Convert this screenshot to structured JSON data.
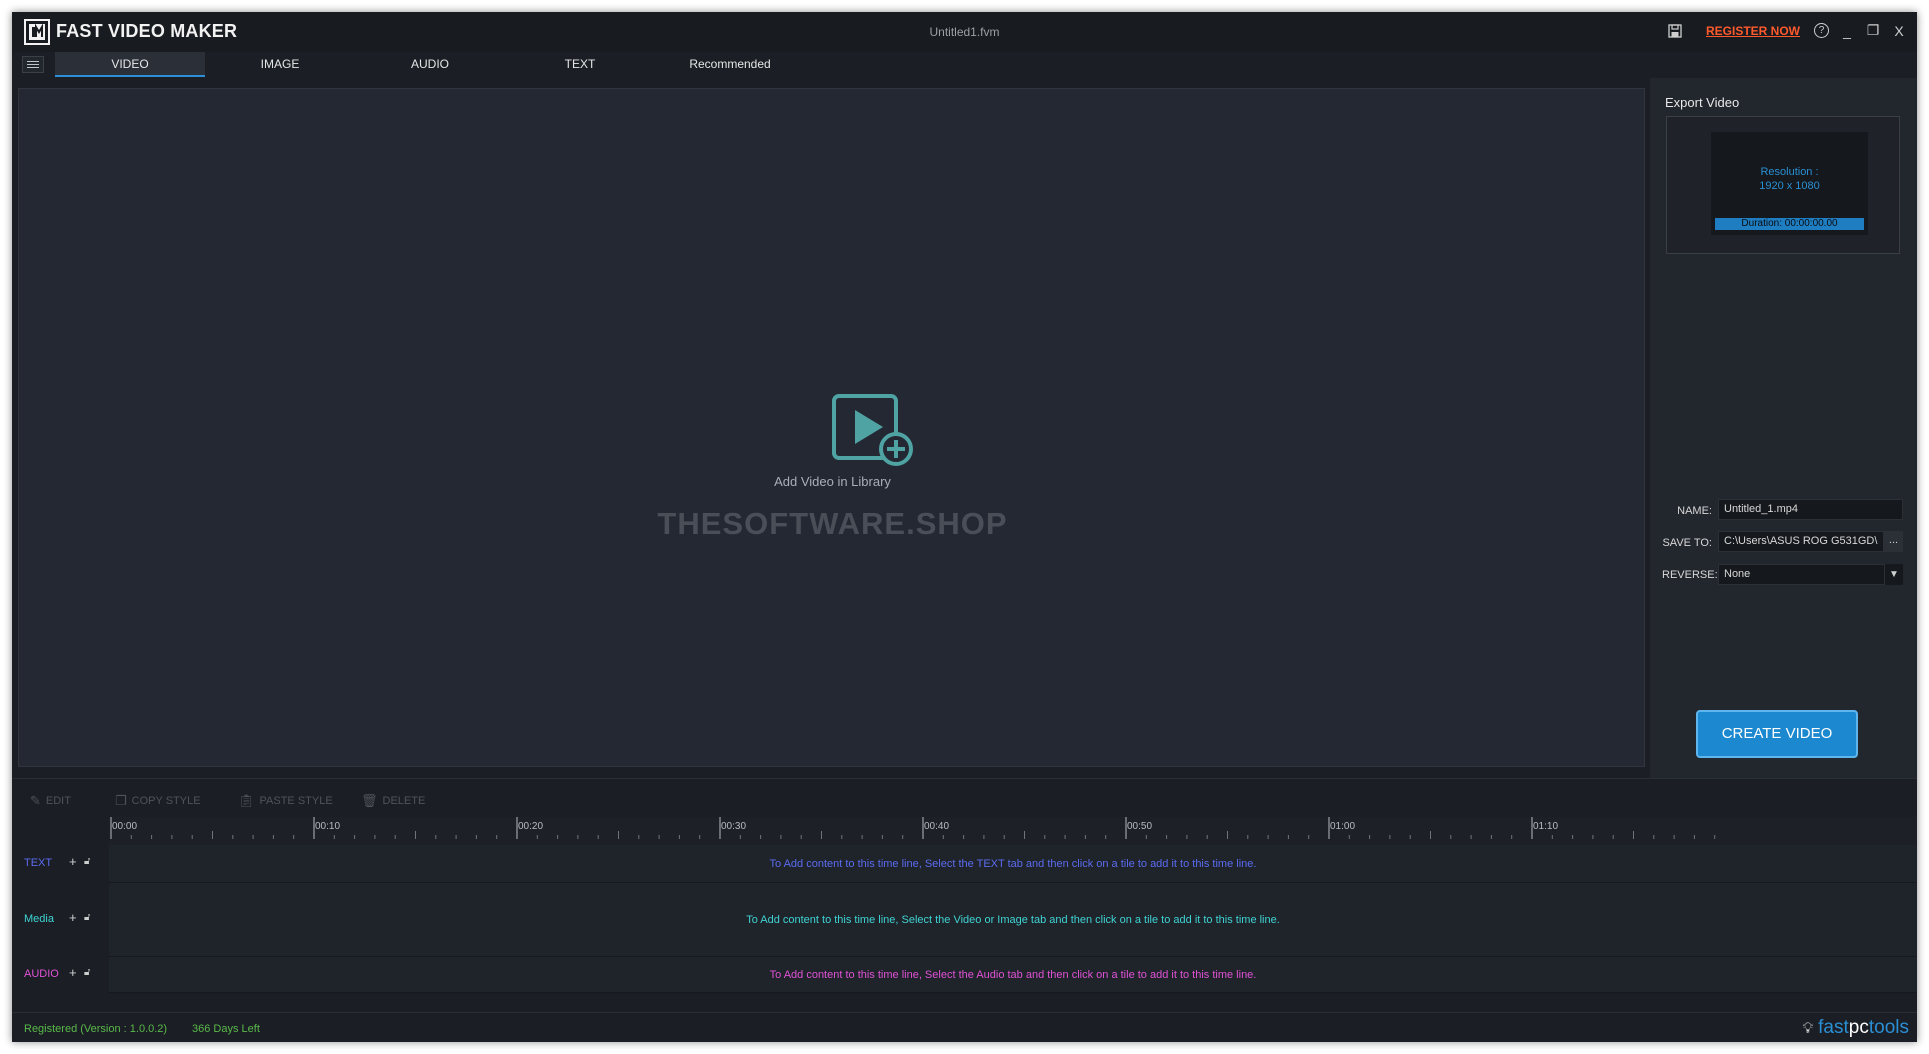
{
  "title_bar": {
    "app_name": "FAST VIDEO MAKER",
    "document_title": "Untitled1.fvm",
    "register_label": "REGISTER NOW",
    "help_symbol": "?",
    "minimize_symbol": "_",
    "restore_symbol": "❐",
    "close_symbol": "X"
  },
  "tabs": [
    "VIDEO",
    "IMAGE",
    "AUDIO",
    "TEXT",
    "Recommended"
  ],
  "active_tab": "VIDEO",
  "preview": {
    "add_label": "Add Video in Library",
    "watermark": "THESOFTWARE.SHOP"
  },
  "export": {
    "title": "Export Video",
    "resolution_label": "Resolution :",
    "resolution_value": "1920 x 1080",
    "duration": "Duration: 00:00:00.00",
    "name_label": "NAME:",
    "name_value": "Untitled_1.mp4",
    "save_to_label": "SAVE TO:",
    "save_to_value": "C:\\Users\\ASUS ROG G531GD\\",
    "browse_label": "...",
    "reverse_label": "REVERSE:",
    "reverse_value": "None",
    "create_label": "CREATE VIDEO"
  },
  "toolbar": {
    "edit": "EDIT",
    "copy_style": "COPY STYLE",
    "paste_style": "PASTE STYLE",
    "delete": "DELETE"
  },
  "timeline": {
    "ticks": [
      "00:00",
      "00:10",
      "00:20",
      "00:30",
      "00:40",
      "00:50",
      "01:00",
      "01:10"
    ],
    "tracks": [
      {
        "name": "TEXT",
        "color": "#5b6cf0",
        "hint": "To Add content to this time line, Select the TEXT tab and then click on a tile to add it to this time line."
      },
      {
        "name": "Media",
        "color": "#3fd4d4",
        "hint": "To Add content to this time line, Select the Video or Image tab and then click on a tile to add it to this time line."
      },
      {
        "name": "AUDIO",
        "color": "#e052d6",
        "hint": "To Add content to this time line, Select the Audio tab and then click on a tile to add it to this time line."
      }
    ]
  },
  "status": {
    "registered": "Registered (Version : 1.0.0.2)",
    "days_left": "366 Days Left",
    "brand_fast": "fast",
    "brand_pc": "pc",
    "brand_tools": "tools"
  },
  "colors": {
    "accent": "#2a8fd4",
    "register": "#ff5a2c",
    "status_green": "#59b94a"
  }
}
